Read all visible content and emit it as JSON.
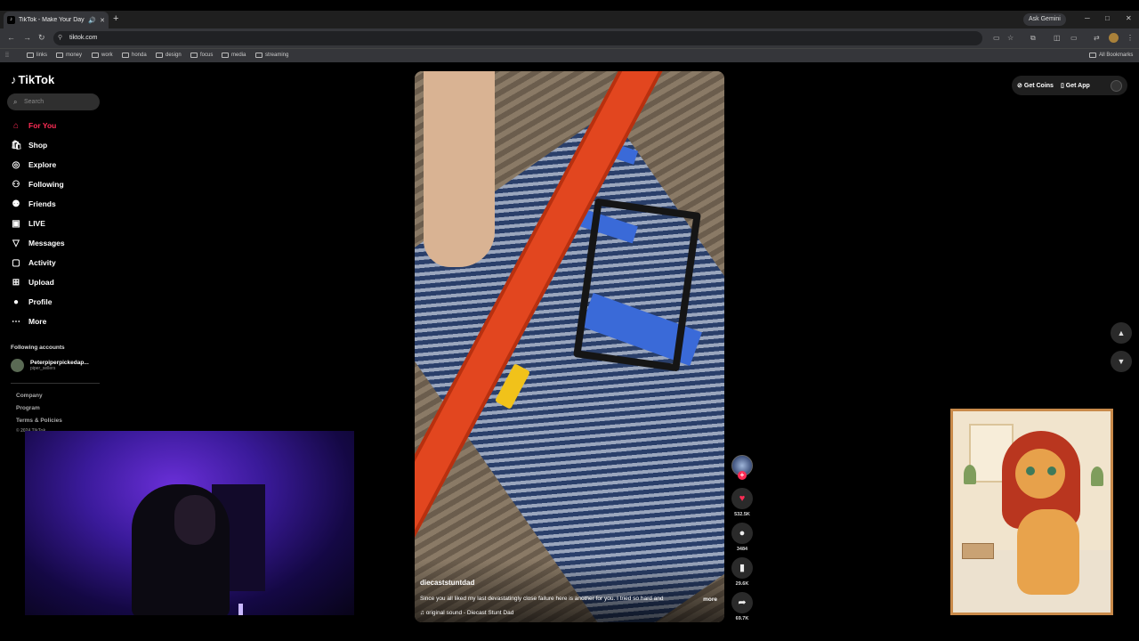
{
  "browser": {
    "tab_title": "TikTok - Make Your Day",
    "url": "tiktok.com",
    "ask_gemini": "Ask Gemini",
    "bookmarks": [
      "links",
      "money",
      "work",
      "honda",
      "design",
      "focus",
      "media",
      "streaming"
    ],
    "all_bookmarks": "All Bookmarks"
  },
  "sidebar": {
    "logo": "TikTok",
    "search_placeholder": "Search",
    "nav": [
      {
        "label": "For You",
        "icon": "home-icon",
        "active": true
      },
      {
        "label": "Shop",
        "icon": "shop-icon"
      },
      {
        "label": "Explore",
        "icon": "explore-icon"
      },
      {
        "label": "Following",
        "icon": "following-icon"
      },
      {
        "label": "Friends",
        "icon": "friends-icon"
      },
      {
        "label": "LIVE",
        "icon": "live-icon"
      },
      {
        "label": "Messages",
        "icon": "messages-icon"
      },
      {
        "label": "Activity",
        "icon": "activity-icon"
      },
      {
        "label": "Upload",
        "icon": "upload-icon"
      },
      {
        "label": "Profile",
        "icon": "profile-icon"
      },
      {
        "label": "More",
        "icon": "more-icon"
      }
    ],
    "following_title": "Following accounts",
    "account": {
      "name": "Peterpiperpickedap...",
      "handle": "piper_sellers"
    },
    "footer": [
      "Company",
      "Program",
      "Terms & Policies",
      "© 2024 TikTok"
    ]
  },
  "video": {
    "author": "diecaststuntdad",
    "caption": "Since you all liked my last devastatingly close failure here is another for you. I tried so hard and",
    "more": "more",
    "sound": "original sound - Diecast Stunt Dad"
  },
  "rail": {
    "likes": "532.5K",
    "comments": "3484",
    "saves": "29.6K",
    "shares": "69.7K"
  },
  "topright": {
    "get_coins": "Get Coins",
    "get_app": "Get App"
  }
}
